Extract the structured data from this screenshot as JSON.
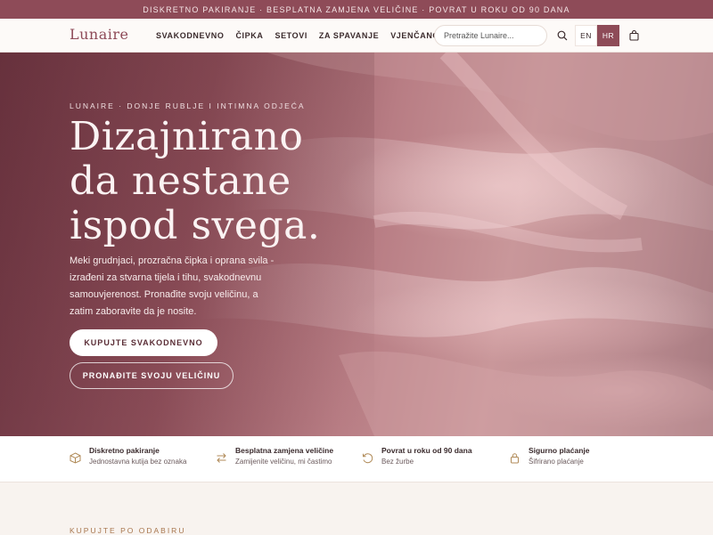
{
  "announcement": "DISKRETNO PAKIRANJE · BESPLATNA ZAMJENA VELIČINE · POVRAT U ROKU OD 90 DANA",
  "brand": "Lunaire",
  "nav": {
    "items": [
      "SVAKODNEVNO",
      "ČIPKA",
      "SETOVI",
      "ZA SPAVANJE",
      "VJENČANO"
    ],
    "search_placeholder": "Pretražite Lunaire...",
    "lang_en": "EN",
    "lang_hr": "HR"
  },
  "hero": {
    "eyebrow": "LUNAIRE · DONJE RUBLJE I INTIMNA ODJEĆA",
    "headline": "Dizajnirano da nestane ispod svega.",
    "lead": "Meki grudnjaci, prozračna čipka i oprana svila - izrađeni za stvarna tijela i tihu, svakodnevnu samouvjerenost. Pronađite svoju veličinu, a zatim zaboravite da je nosite.",
    "primary_cta": "KUPUJTE SVAKODNEVNO",
    "secondary_cta": "PRONAĐITE SVOJU VELIČINU"
  },
  "features": [
    {
      "icon": "box-icon",
      "title": "Diskretno pakiranje",
      "subtitle": "Jednostavna kutija bez oznaka"
    },
    {
      "icon": "swap-icon",
      "title": "Besplatna zamjena veličine",
      "subtitle": "Zamijenite veličinu, mi častimo"
    },
    {
      "icon": "return-icon",
      "title": "Povrat u roku od 90 dana",
      "subtitle": "Bez žurbe"
    },
    {
      "icon": "lock-icon",
      "title": "Sigurno plaćanje",
      "subtitle": "Šifrirano plaćanje"
    }
  ],
  "section_label": "KUPUJTE PO ODABIRU",
  "colors": {
    "accent": "#8e4b58",
    "gold": "#b08a57"
  }
}
